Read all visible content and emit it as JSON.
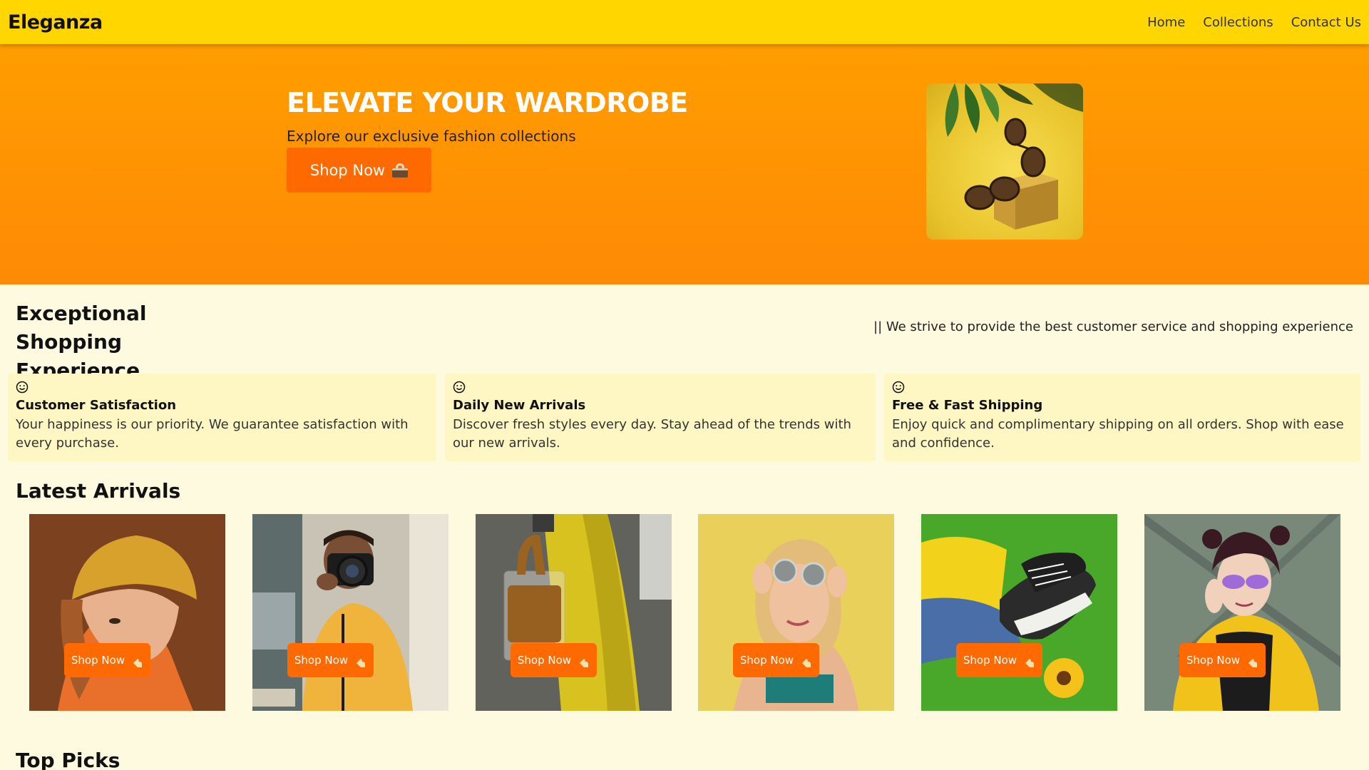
{
  "nav": {
    "brand": "Eleganza",
    "links": [
      "Home",
      "Collections",
      "Contact Us"
    ]
  },
  "hero": {
    "title": "ELEVATE YOUR WARDROBE",
    "subtitle": "Explore our exclusive fashion collections",
    "cta_label": "Shop Now"
  },
  "experience": {
    "title_line1": "Exceptional",
    "title_line2": "Shopping Experience",
    "tagline": "|| We strive to provide the best customer service and shopping experience",
    "features": [
      {
        "title": "Customer Satisfaction",
        "description": "Your happiness is our priority. We guarantee satisfaction with every purchase.",
        "icon": "smile-icon"
      },
      {
        "title": "Daily New Arrivals",
        "description": "Discover fresh styles every day. Stay ahead of the trends with our new arrivals.",
        "icon": "smile-icon"
      },
      {
        "title": "Free & Fast Shipping",
        "description": "Enjoy quick and complimentary shipping on all orders. Shop with ease and confidence.",
        "icon": "smile-icon"
      }
    ]
  },
  "arrivals": {
    "title": "Latest Arrivals",
    "button_label": "Shop Now",
    "products": [
      {
        "image": "woman-yellow-beanie"
      },
      {
        "image": "man-with-camera"
      },
      {
        "image": "woman-with-handbag"
      },
      {
        "image": "woman-with-sunglasses"
      },
      {
        "image": "sneakers-on-grass"
      },
      {
        "image": "woman-yellow-jacket"
      }
    ]
  },
  "top_picks": {
    "title": "Top Picks"
  },
  "colors": {
    "navbar": "#ffd600",
    "hero_gradient_top": "#ff9d00",
    "hero_gradient_bottom": "#ff8a05",
    "accent_button": "#ff6a00",
    "page_background": "#fefae0",
    "card_background": "#fef6c3"
  }
}
